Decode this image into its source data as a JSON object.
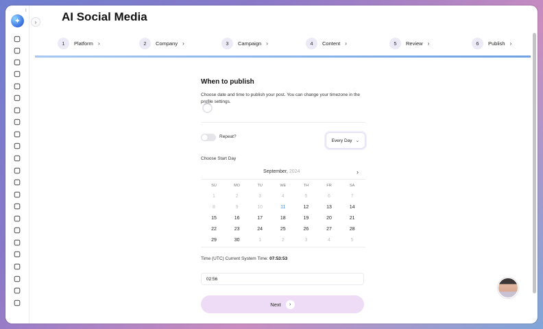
{
  "app": {
    "title": "AI Social Media",
    "logo_icon": "sparkle-icon",
    "logo_badge": "I",
    "collapse_glyph": "›"
  },
  "sidebar": {
    "icons": [
      "grid-icon",
      "palette-icon",
      "users-icon",
      "sixty-icon",
      "megaphone-icon",
      "at-icon",
      "checklist-icon",
      "chat-icon",
      "monitor-icon",
      "calendar-icon",
      "document-icon",
      "pen-icon",
      "dollar-icon",
      "card-icon",
      "mail-icon",
      "keyboard-icon",
      "laptop-icon",
      "pulse-icon",
      "clipboard-icon",
      "refresh-icon",
      "menu-icon",
      "briefcase-icon",
      "network-icon"
    ]
  },
  "stepper": {
    "steps": [
      {
        "number": "1",
        "label": "Platform"
      },
      {
        "number": "2",
        "label": "Company"
      },
      {
        "number": "3",
        "label": "Campaign"
      },
      {
        "number": "4",
        "label": "Content"
      },
      {
        "number": "5",
        "label": "Review"
      },
      {
        "number": "6",
        "label": "Publish"
      }
    ],
    "chevron": "›"
  },
  "publish": {
    "heading": "When to publish",
    "description": "Choose date and time to publish your post. You can change your timezone in the profile settings.",
    "repeat_label": "Repeat?",
    "repeat_enabled": false,
    "frequency": "Every Day",
    "start_label": "Choose Start Day",
    "time_label": "Time (UTC) Current System Time:",
    "system_time": "07:53:53",
    "time_value": "02:56",
    "next_label": "Next",
    "next_glyph": "›"
  },
  "calendar": {
    "month": "September,",
    "year": "2024",
    "next_glyph": "›",
    "weekdays": [
      "SU",
      "MO",
      "TU",
      "WE",
      "TH",
      "FR",
      "SA"
    ],
    "weeks": [
      [
        {
          "d": "1",
          "s": "muted"
        },
        {
          "d": "2",
          "s": "muted"
        },
        {
          "d": "3",
          "s": "muted"
        },
        {
          "d": "4",
          "s": "muted"
        },
        {
          "d": "5",
          "s": "muted"
        },
        {
          "d": "6",
          "s": "muted"
        },
        {
          "d": "7",
          "s": "muted"
        }
      ],
      [
        {
          "d": "8",
          "s": "muted"
        },
        {
          "d": "9",
          "s": "muted"
        },
        {
          "d": "10",
          "s": "muted"
        },
        {
          "d": "11",
          "s": "today"
        },
        {
          "d": "12",
          "s": ""
        },
        {
          "d": "13",
          "s": ""
        },
        {
          "d": "14",
          "s": ""
        }
      ],
      [
        {
          "d": "15",
          "s": ""
        },
        {
          "d": "16",
          "s": ""
        },
        {
          "d": "17",
          "s": ""
        },
        {
          "d": "18",
          "s": ""
        },
        {
          "d": "19",
          "s": ""
        },
        {
          "d": "20",
          "s": ""
        },
        {
          "d": "21",
          "s": ""
        }
      ],
      [
        {
          "d": "22",
          "s": ""
        },
        {
          "d": "23",
          "s": ""
        },
        {
          "d": "24",
          "s": ""
        },
        {
          "d": "25",
          "s": ""
        },
        {
          "d": "26",
          "s": ""
        },
        {
          "d": "27",
          "s": ""
        },
        {
          "d": "28",
          "s": ""
        }
      ],
      [
        {
          "d": "29",
          "s": ""
        },
        {
          "d": "30",
          "s": ""
        },
        {
          "d": "1",
          "s": "muted"
        },
        {
          "d": "2",
          "s": "muted"
        },
        {
          "d": "3",
          "s": "muted"
        },
        {
          "d": "4",
          "s": "muted"
        },
        {
          "d": "5",
          "s": "muted"
        }
      ]
    ]
  },
  "colors": {
    "accent": "#3b8be6",
    "progress": "#6fa2e6",
    "next_button_bg": "#eedcf6"
  }
}
